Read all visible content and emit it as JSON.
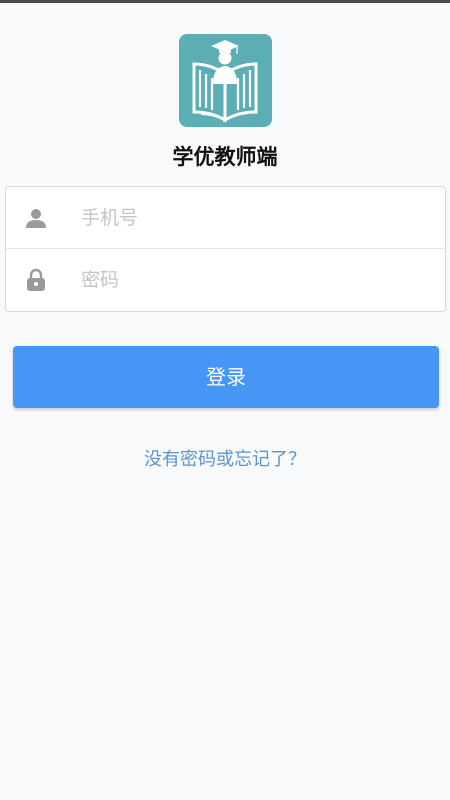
{
  "app": {
    "title": "学优教师端",
    "logo_icon": "open-book-graduate-icon"
  },
  "login_form": {
    "phone": {
      "icon": "user-icon",
      "placeholder": "手机号",
      "value": ""
    },
    "password": {
      "icon": "lock-icon",
      "placeholder": "密码",
      "value": ""
    },
    "submit_label": "登录",
    "forgot_link": "没有密码或忘记了？"
  },
  "colors": {
    "accent": "#4596f5",
    "logo_bg": "#5aaeb4",
    "link": "#5e95c8",
    "background": "#f8f9fa"
  }
}
